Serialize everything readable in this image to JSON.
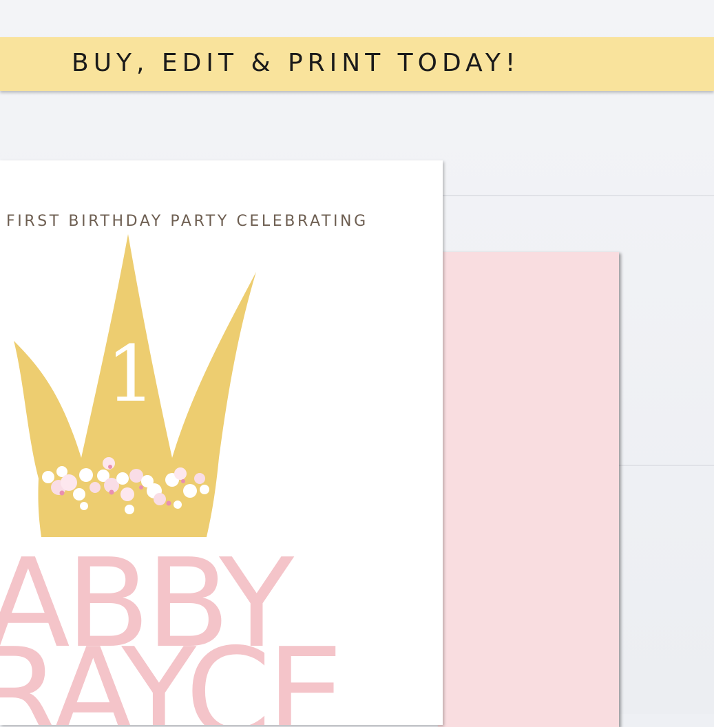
{
  "banner": {
    "text": "BUY, EDIT & PRINT TODAY!"
  },
  "card": {
    "heading": "FIRST BIRTHDAY PARTY CELEBRATING",
    "age": "1",
    "name_first": "ABBY",
    "name_second": "RAYCE"
  },
  "colors": {
    "banner": "#f9e39c",
    "crown": "#edcd70",
    "name_pink": "#f4c4c9",
    "envelope": "#f9dde0",
    "heading_brown": "#6e5f52"
  },
  "icons": {
    "crown": "crown-icon",
    "flowers": "flower-cluster-icon"
  }
}
